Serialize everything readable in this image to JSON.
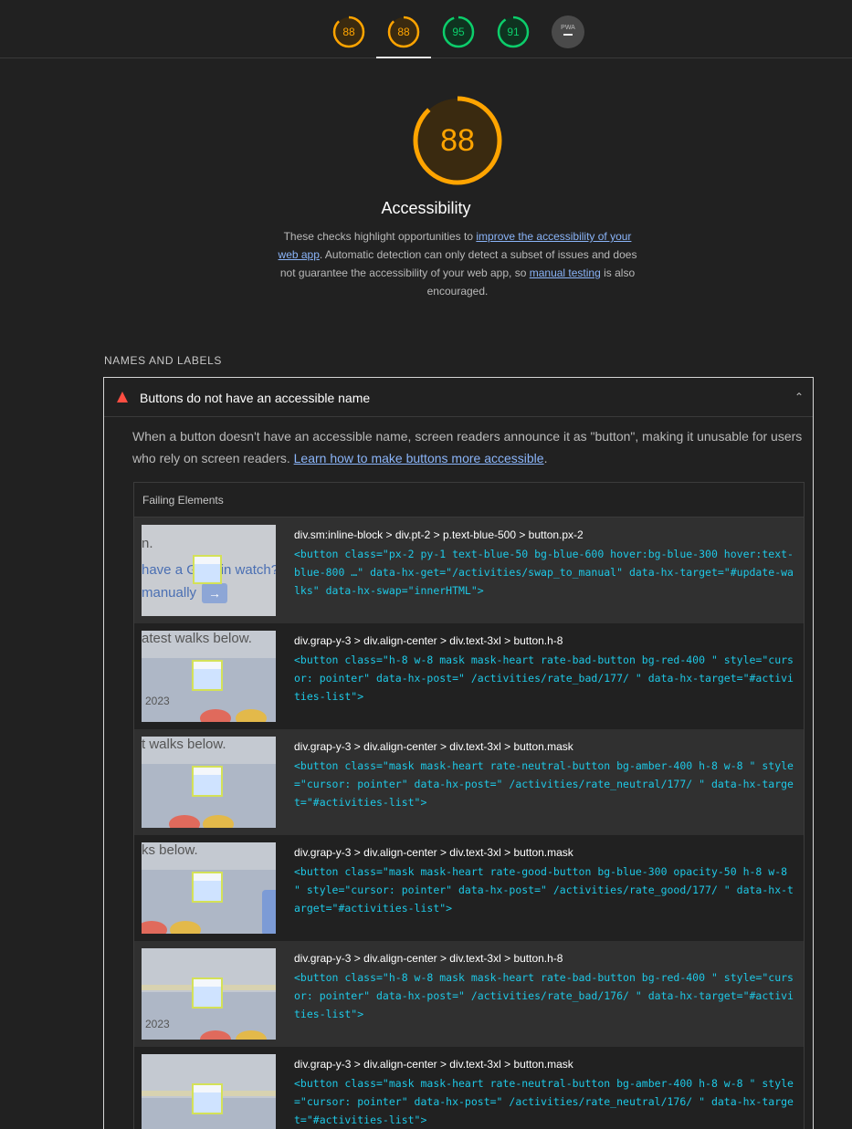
{
  "scores": [
    {
      "value": "88",
      "color": "#ffa400"
    },
    {
      "value": "88",
      "color": "#ffa400"
    },
    {
      "value": "95",
      "color": "#0cce6b"
    },
    {
      "value": "91",
      "color": "#0cce6b"
    }
  ],
  "pwa_label": "PWA",
  "hero": {
    "score": "88",
    "score_fraction": 0.88,
    "title": "Accessibility",
    "desc_1": "These checks highlight opportunities to ",
    "link_1": "improve the accessibility of your web app",
    "desc_2": ". Automatic detection can only detect a subset of issues and does not guarantee the accessibility of your web app, so ",
    "link_2": "manual testing",
    "desc_3": " is also encouraged."
  },
  "section_label": "NAMES AND LABELS",
  "audit": {
    "title": "Buttons do not have an accessible name",
    "chevron": "⌃",
    "desc": "When a button doesn't have an accessible name, screen readers announce it as \"button\", making it unusable for users who rely on screen readers. ",
    "link": "Learn how to make buttons more accessible",
    "desc_end": ".",
    "table_header": "Failing Elements",
    "rows": [
      {
        "path": "div.sm:inline-block > div.pt-2 > p.text-blue-500 > button.px-2",
        "code": "<button class=\"px-2 py-1 text-blue-50 bg-blue-600 hover:bg-blue-300 hover:text-blue-800 …\" data-hx-get=\"/activities/swap_to_manual\" data-hx-target=\"#update-walks\" data-hx-swap=\"innerHTML\">",
        "thumb_line1": "n.",
        "thumb_line2": "have a Garmin watch?",
        "thumb_line3": "manually"
      },
      {
        "path": "div.grap-y-3 > div.align-center > div.text-3xl > button.h-8",
        "code": "<button class=\"h-8 w-8 mask mask-heart rate-bad-button bg-red-400 \" style=\"cursor: pointer\" data-hx-post=\" /activities/rate_bad/177/ \" data-hx-target=\"#activities-list\">",
        "thumb_line1": "atest walks below.",
        "thumb_line2": "2023"
      },
      {
        "path": "div.grap-y-3 > div.align-center > div.text-3xl > button.mask",
        "code": "<button class=\"mask mask-heart rate-neutral-button bg-amber-400 h-8 w-8 \" style=\"cursor: pointer\" data-hx-post=\" /activities/rate_neutral/177/ \" data-hx-target=\"#activities-list\">",
        "thumb_line1": "t walks below."
      },
      {
        "path": "div.grap-y-3 > div.align-center > div.text-3xl > button.mask",
        "code": "<button class=\"mask mask-heart rate-good-button bg-blue-300 opacity-50 h-8 w-8 \" style=\"cursor: pointer\" data-hx-post=\" /activities/rate_good/177/ \" data-hx-target=\"#activities-list\">",
        "thumb_line1": "ks below."
      },
      {
        "path": "div.grap-y-3 > div.align-center > div.text-3xl > button.h-8",
        "code": "<button class=\"h-8 w-8 mask mask-heart rate-bad-button bg-red-400 \" style=\"cursor: pointer\" data-hx-post=\" /activities/rate_bad/176/ \" data-hx-target=\"#activities-list\">",
        "thumb_line1": "2023"
      },
      {
        "path": "div.grap-y-3 > div.align-center > div.text-3xl > button.mask",
        "code": "<button class=\"mask mask-heart rate-neutral-button bg-amber-400 h-8 w-8 \" style=\"cursor: pointer\" data-hx-post=\" /activities/rate_neutral/176/ \" data-hx-target=\"#activities-list\">"
      }
    ]
  }
}
